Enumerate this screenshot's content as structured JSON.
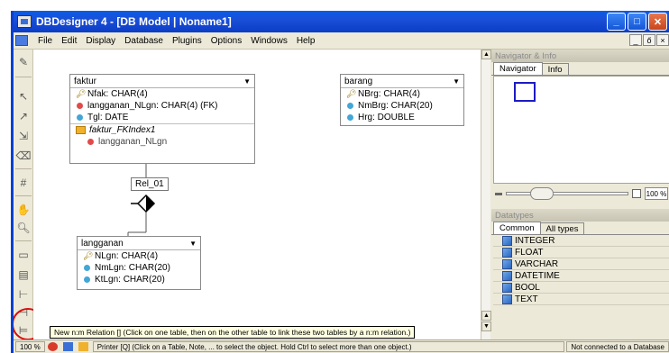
{
  "window": {
    "title": "DBDesigner 4 - [DB Model | Noname1]"
  },
  "menu": [
    "File",
    "Edit",
    "Display",
    "Database",
    "Plugins",
    "Options",
    "Windows",
    "Help"
  ],
  "mdi_controls": [
    "_",
    "ő",
    "×"
  ],
  "tables": {
    "faktur": {
      "name": "faktur",
      "columns": [
        {
          "text": "Nfak: CHAR(4)",
          "kind": "pk"
        },
        {
          "text": "langganan_NLgn: CHAR(4) (FK)",
          "kind": "fk"
        },
        {
          "text": "Tgl: DATE",
          "kind": "col"
        }
      ],
      "index_name": "faktur_FKIndex1",
      "index_columns": [
        "langganan_NLgn"
      ]
    },
    "barang": {
      "name": "barang",
      "columns": [
        {
          "text": "NBrg: CHAR(4)",
          "kind": "pk"
        },
        {
          "text": "NmBrg: CHAR(20)",
          "kind": "col"
        },
        {
          "text": "Hrg: DOUBLE",
          "kind": "col"
        }
      ]
    },
    "langganan": {
      "name": "langganan",
      "columns": [
        {
          "text": "NLgn: CHAR(4)",
          "kind": "pk"
        },
        {
          "text": "NmLgn: CHAR(20)",
          "kind": "col"
        },
        {
          "text": "KtLgn: CHAR(20)",
          "kind": "col"
        }
      ]
    }
  },
  "relation_label": "Rel_01",
  "tooltip": "New n:m Relation [] (Click on one table, then on the other table to link these two tables by a n:m relation.)",
  "navigator": {
    "title": "Navigator & Info",
    "tabs": [
      "Navigator",
      "Info"
    ],
    "zoom_value": "100 %"
  },
  "datatypes": {
    "title": "Datatypes",
    "tabs": [
      "Common",
      "All types"
    ],
    "items": [
      "INTEGER",
      "FLOAT",
      "VARCHAR",
      "DATETIME",
      "BOOL",
      "TEXT"
    ]
  },
  "statusbar": {
    "zoom": "100 %",
    "message": "Printer [Q] (Click on a Table, Note, ... to select the object. Hold Ctrl to select more than one object.)",
    "connection": "Not connected to a Database"
  }
}
